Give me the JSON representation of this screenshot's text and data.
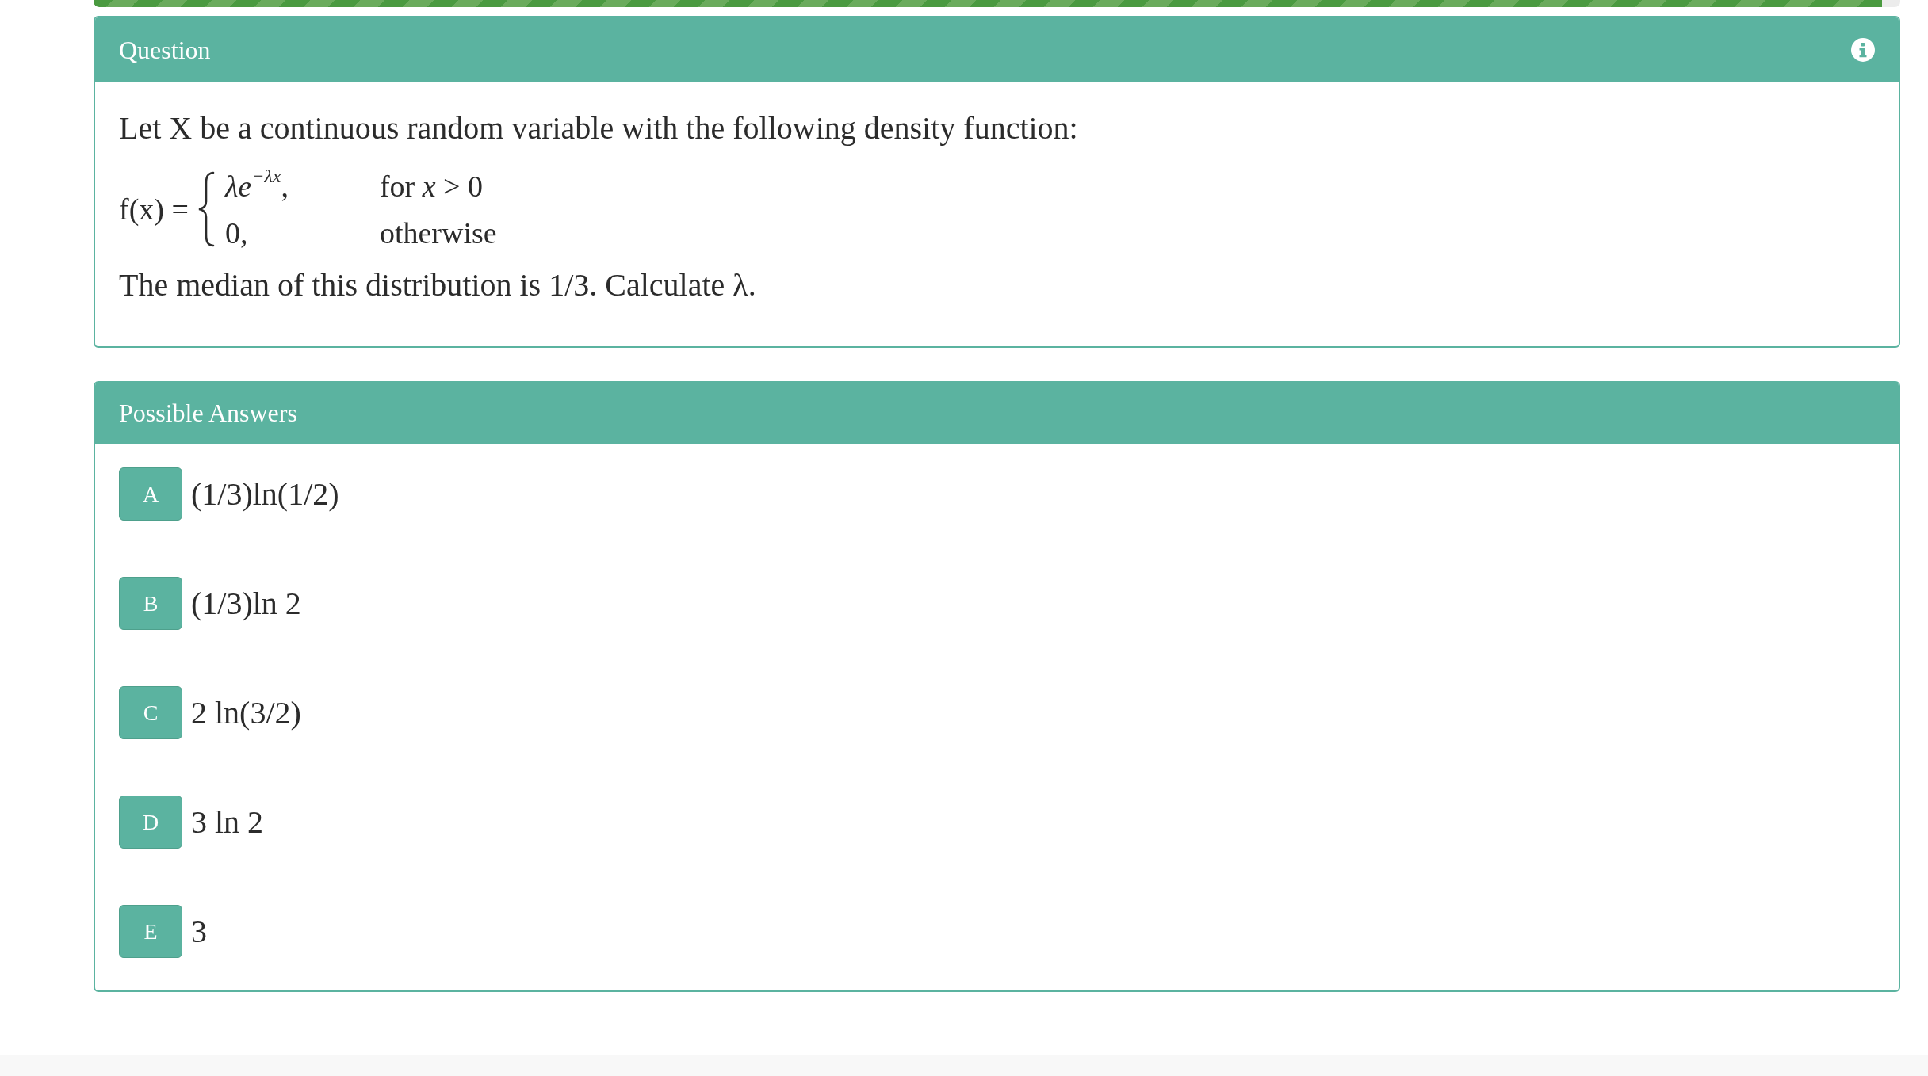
{
  "progress": {
    "level": 0.99
  },
  "question": {
    "title": "Question",
    "intro": "Let X be a continuous random variable with the following density function:",
    "formula": {
      "lhs": "f(x) =",
      "cases": [
        {
          "expression": "*λe*$^{−λx}$,",
          "condition": "for *x* > 0"
        },
        {
          "expression": "0,",
          "condition": "otherwise"
        }
      ]
    },
    "closing": "The median of this distribution is 1/3. Calculate λ."
  },
  "answers": {
    "title": "Possible Answers",
    "options": [
      {
        "letter": "A",
        "text": "(1/3)ln(1/2)",
        "selected": false
      },
      {
        "letter": "B",
        "text": "(1/3)ln 2",
        "selected": false
      },
      {
        "letter": "C",
        "text": "2 ln(3/2)",
        "selected": false
      },
      {
        "letter": "D",
        "text": "3 ln 2",
        "selected": false
      },
      {
        "letter": "E",
        "text": "3",
        "selected": false
      }
    ]
  }
}
